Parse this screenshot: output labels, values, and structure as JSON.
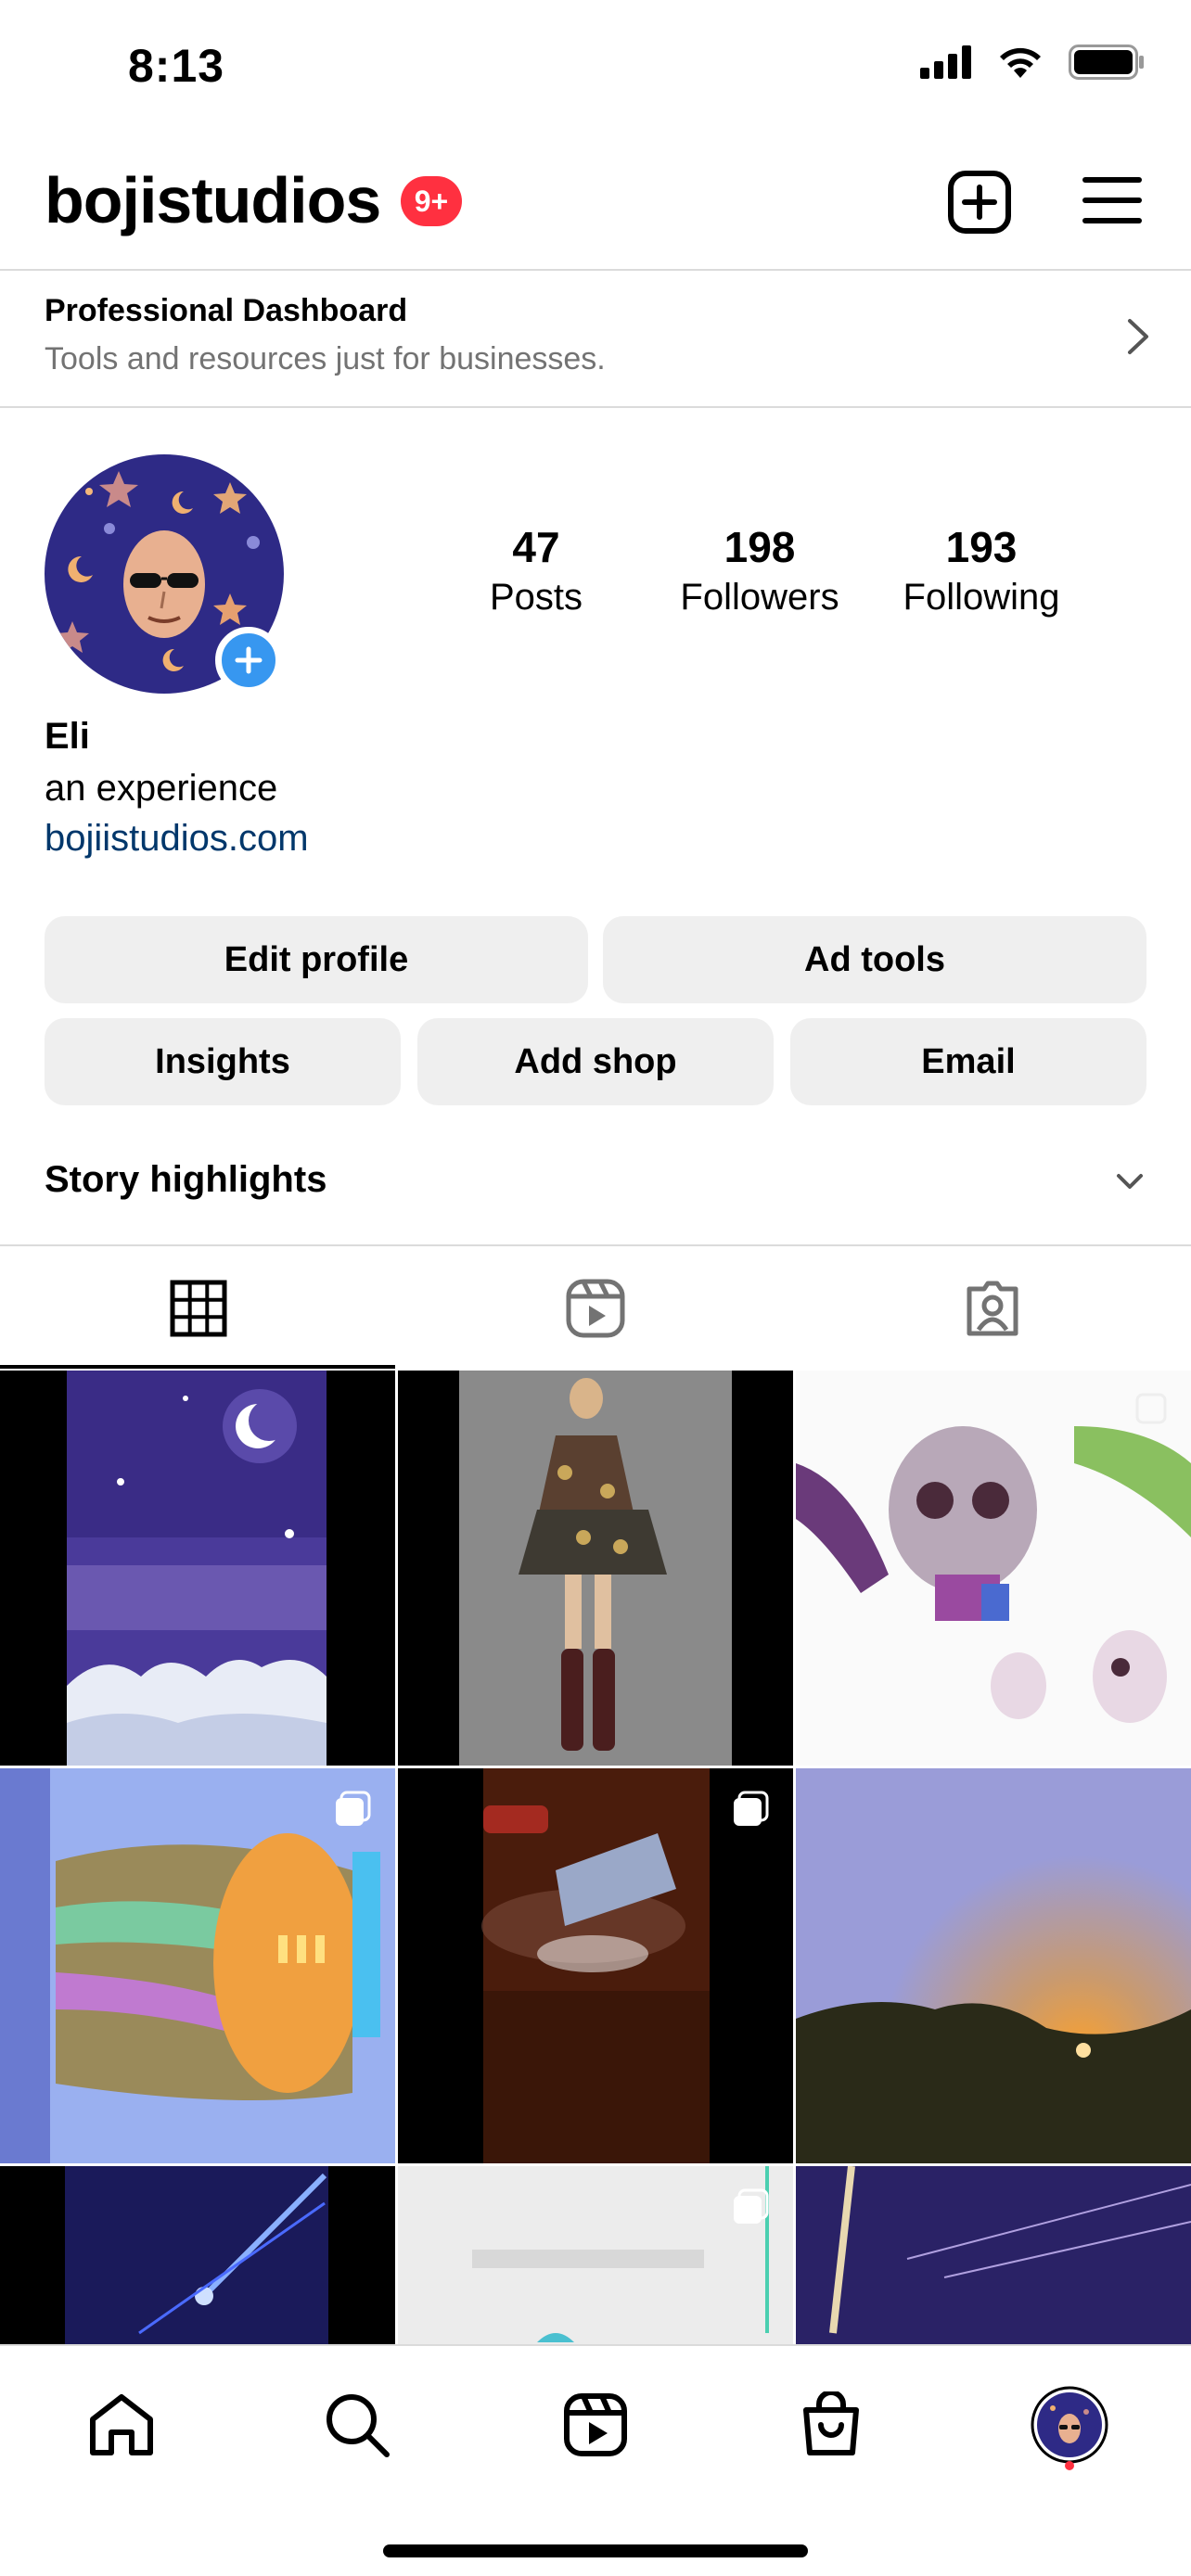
{
  "status_bar": {
    "time": "8:13"
  },
  "header": {
    "username": "bojistudios",
    "notification_badge": "9+"
  },
  "professional_dashboard": {
    "title": "Professional Dashboard",
    "subtitle": "Tools and resources just for businesses."
  },
  "profile": {
    "stats": [
      {
        "value": "47",
        "label": "Posts"
      },
      {
        "value": "198",
        "label": "Followers"
      },
      {
        "value": "193",
        "label": "Following"
      }
    ],
    "name": "Eli",
    "bio": "an experience",
    "link": "bojiistudios.com"
  },
  "buttons": {
    "edit_profile": "Edit profile",
    "ad_tools": "Ad tools",
    "insights": "Insights",
    "add_shop": "Add shop",
    "email": "Email"
  },
  "story_highlights": {
    "label": "Story highlights"
  },
  "tabs": [
    "grid-icon",
    "reels-icon",
    "tagged-icon"
  ],
  "bottom_nav": [
    "home-icon",
    "search-icon",
    "reels-icon",
    "shop-icon",
    "profile-avatar"
  ],
  "colors": {
    "badge": "#ff3040",
    "link": "#00376b",
    "button_bg": "#efefef",
    "add_blue": "#3797f0"
  }
}
